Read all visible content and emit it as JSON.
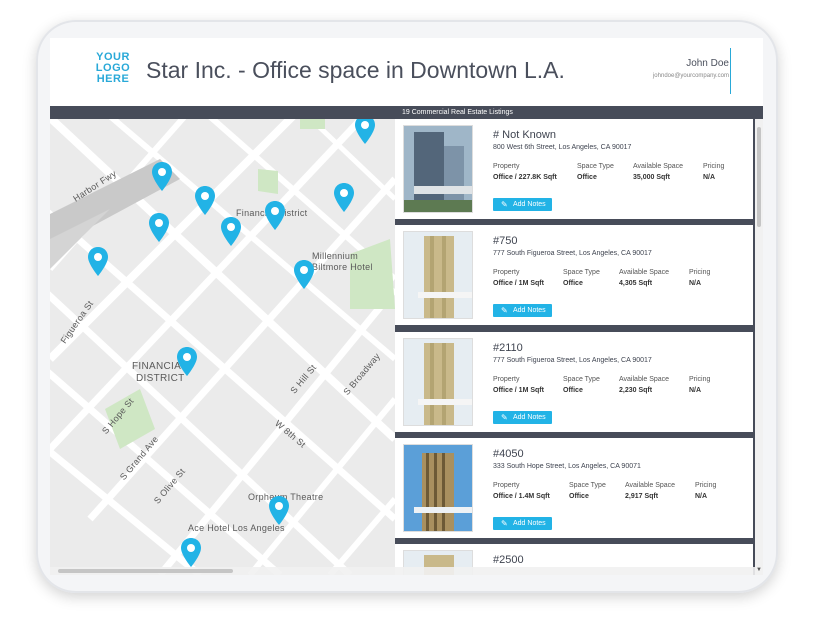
{
  "header": {
    "logo": "YOUR LOGO HERE",
    "title": "Star Inc. - Office space in Downtown L.A.",
    "user_name": "John Doe",
    "user_email": "johndoe@yourcompany.com"
  },
  "subbar": {
    "listing_count": "19 Commercial Real Estate Listings"
  },
  "map": {
    "labels": {
      "harbor_fwy": "Harbor Fwy",
      "financial_district_top": "Financial District",
      "millennium": "Millennium",
      "biltmore": "Biltmore Hotel",
      "figueroa": "Figueroa St",
      "financial_district_1": "FINANCIAL",
      "financial_district_2": "DISTRICT",
      "s_hill": "S Hill St",
      "s_broadway": "S Broadway",
      "s_hope": "S Hope St",
      "s_grand": "S Grand Ave",
      "w_8th": "W 8th St",
      "s_olive": "S Olive St",
      "orpheum": "Orpheum Theatre",
      "ace_hotel": "Ace Hotel Los Angeles"
    },
    "pin_color": "#22b3e6"
  },
  "field_labels": {
    "property": "Property",
    "space_type": "Space Type",
    "available_space": "Available Space",
    "pricing": "Pricing",
    "add_notes": "Add Notes"
  },
  "listings": [
    {
      "title": "# Not Known",
      "address": "800 West 6th Street, Los Angeles, CA 90017",
      "property": "Office / 227.8K Sqft",
      "space_type": "Office",
      "available_space": "35,000 Sqft",
      "pricing": "N/A"
    },
    {
      "title": "#750",
      "address": "777 South Figueroa Street, Los Angeles, CA 90017",
      "property": "Office / 1M Sqft",
      "space_type": "Office",
      "available_space": "4,305 Sqft",
      "pricing": "N/A"
    },
    {
      "title": "#2110",
      "address": "777 South Figueroa Street, Los Angeles, CA 90017",
      "property": "Office / 1M Sqft",
      "space_type": "Office",
      "available_space": "2,230 Sqft",
      "pricing": "N/A"
    },
    {
      "title": "#4050",
      "address": "333 South Hope Street, Los Angeles, CA 90071",
      "property": "Office / 1.4M Sqft",
      "space_type": "Office",
      "available_space": "2,917 Sqft",
      "pricing": "N/A"
    },
    {
      "title": "#2500"
    }
  ],
  "colors": {
    "accent": "#22b3e6",
    "dark_bar": "#474c59"
  }
}
